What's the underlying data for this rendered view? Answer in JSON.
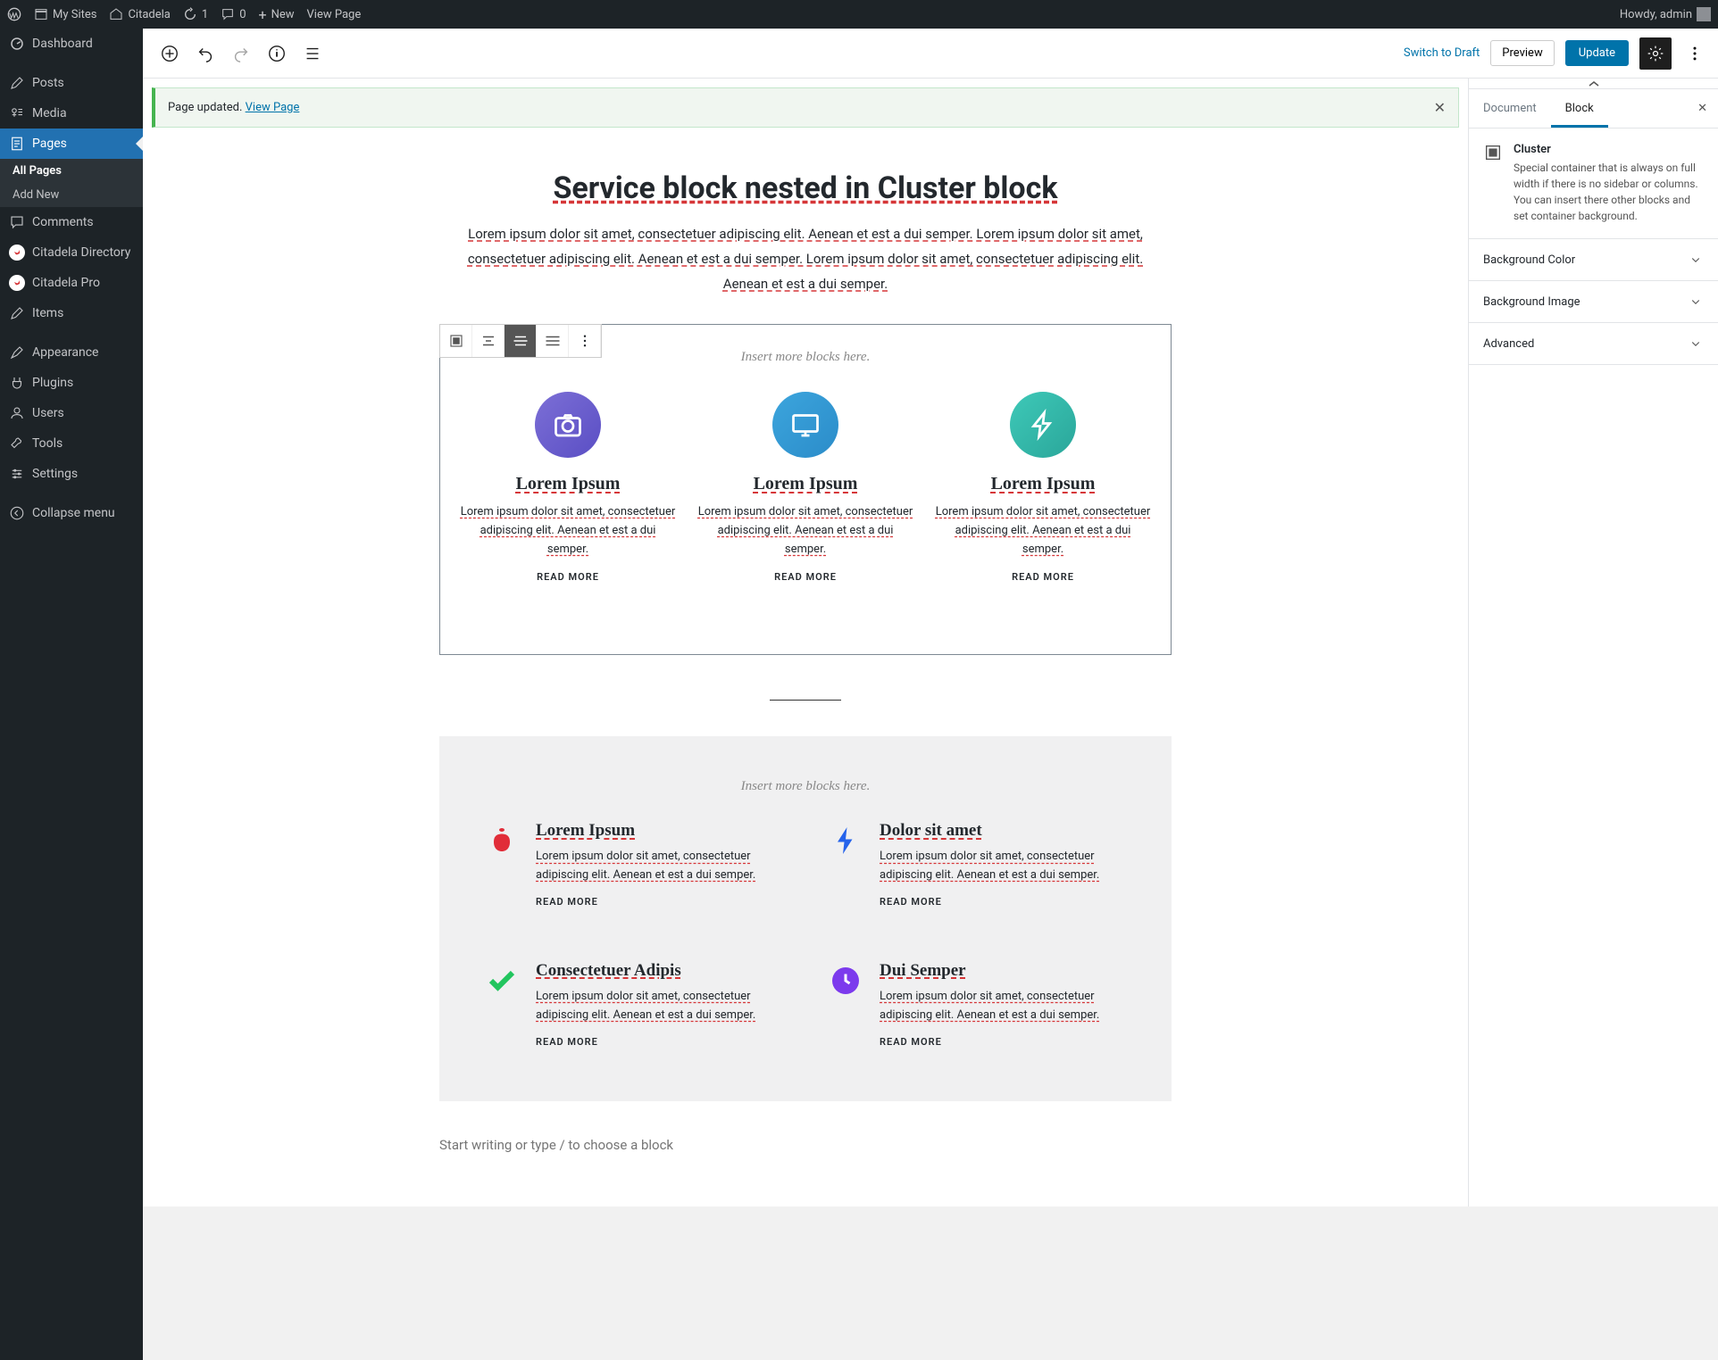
{
  "adminbar": {
    "mysites": "My Sites",
    "sitename": "Citadela",
    "updates": "1",
    "comments": "0",
    "new": "New",
    "viewpage": "View Page",
    "howdy": "Howdy, admin"
  },
  "sidebar": {
    "items": [
      {
        "label": "Dashboard"
      },
      {
        "label": "Posts"
      },
      {
        "label": "Media"
      },
      {
        "label": "Pages"
      },
      {
        "label": "Comments"
      },
      {
        "label": "Citadela Directory"
      },
      {
        "label": "Citadela Pro"
      },
      {
        "label": "Items"
      },
      {
        "label": "Appearance"
      },
      {
        "label": "Plugins"
      },
      {
        "label": "Users"
      },
      {
        "label": "Tools"
      },
      {
        "label": "Settings"
      },
      {
        "label": "Collapse menu"
      }
    ],
    "sub": {
      "allpages": "All Pages",
      "addnew": "Add New"
    }
  },
  "toolbar": {
    "switchdraft": "Switch to Draft",
    "preview": "Preview",
    "update": "Update"
  },
  "notice": {
    "text": "Page updated. ",
    "link": "View Page"
  },
  "page": {
    "title": "Service block nested in Cluster block",
    "intro": "Lorem ipsum dolor sit amet, consectetuer adipiscing elit. Aenean et est a dui semper. Lorem ipsum dolor sit amet, consectetuer adipiscing elit. Aenean et est a dui semper.   Lorem ipsum dolor sit amet, consectetuer adipiscing elit. Aenean et est a dui semper.",
    "placeholder": "Insert more blocks here.",
    "services": [
      {
        "title": "Lorem Ipsum",
        "desc": "Lorem ipsum dolor sit amet, consectetuer adipiscing elit. Aenean et est a dui semper.",
        "more": "READ MORE"
      },
      {
        "title": "Lorem Ipsum",
        "desc": "Lorem ipsum dolor sit amet, consectetuer adipiscing elit. Aenean et est a dui semper.",
        "more": "READ MORE"
      },
      {
        "title": "Lorem Ipsum",
        "desc": "Lorem ipsum dolor sit amet, consectetuer adipiscing elit. Aenean et est a dui semper.",
        "more": "READ MORE"
      }
    ],
    "services2": [
      {
        "title": "Lorem Ipsum",
        "desc": "Lorem ipsum dolor sit amet, consectetuer adipiscing elit. Aenean et est a dui semper.",
        "more": "READ MORE"
      },
      {
        "title": "Dolor sit amet",
        "desc": "Lorem ipsum dolor sit amet, consectetuer adipiscing elit. Aenean et est a dui semper.",
        "more": "READ MORE"
      },
      {
        "title": "Consectetuer Adipis",
        "desc": "Lorem ipsum dolor sit amet, consectetuer adipiscing elit. Aenean et est a dui semper.",
        "more": "READ MORE"
      },
      {
        "title": "Dui Semper",
        "desc": "Lorem ipsum dolor sit amet, consectetuer adipiscing elit. Aenean et est a dui semper.",
        "more": "READ MORE"
      }
    ],
    "writing": "Start writing or type / to choose a block"
  },
  "rightpanel": {
    "tabs": {
      "document": "Document",
      "block": "Block"
    },
    "block": {
      "title": "Cluster",
      "desc": "Special container that is always on full width if there is no sidebar or columns. You can insert there other blocks and set container background."
    },
    "sections": {
      "bgcolor": "Background Color",
      "bgimage": "Background Image",
      "advanced": "Advanced"
    }
  }
}
